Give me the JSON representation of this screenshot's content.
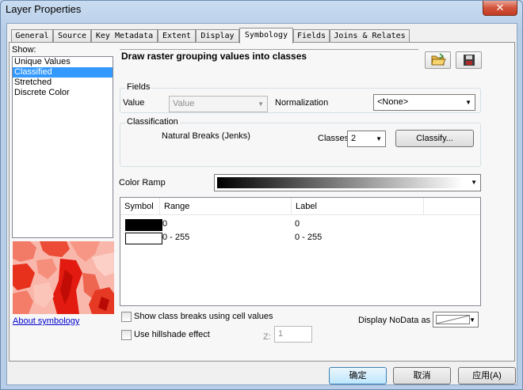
{
  "window": {
    "title": "Layer Properties",
    "close_glyph": "✕"
  },
  "tabs": [
    {
      "label": "General"
    },
    {
      "label": "Source"
    },
    {
      "label": "Key Metadata"
    },
    {
      "label": "Extent"
    },
    {
      "label": "Display"
    },
    {
      "label": "Symbology",
      "active": true
    },
    {
      "label": "Fields"
    },
    {
      "label": "Joins & Relates"
    }
  ],
  "show": {
    "label": "Show:",
    "items": [
      "Unique Values",
      "Classified",
      "Stretched",
      "Discrete Color"
    ],
    "selected": "Classified",
    "about_link": "About symbology"
  },
  "heading": "Draw raster grouping values into classes",
  "icons": {
    "open": "folder-open-icon",
    "save": "floppy-disk-icon"
  },
  "fields": {
    "legend": "Fields",
    "value_label": "Value",
    "value_combo": "Value",
    "normalization_label": "Normalization",
    "normalization_combo": "<None>"
  },
  "classification": {
    "legend": "Classification",
    "method": "Natural Breaks (Jenks)",
    "classes_label": "Classes",
    "classes_value": "2",
    "classify_button": "Classify..."
  },
  "color_ramp": {
    "label": "Color Ramp",
    "from_color": "#000000",
    "to_color": "#ffffff"
  },
  "table": {
    "columns": [
      "Symbol",
      "Range",
      "Label"
    ],
    "rows": [
      {
        "color": "#000000",
        "range": "0",
        "label": "0"
      },
      {
        "color": "#ffffff",
        "range": "0 - 255",
        "label": "0 - 255"
      }
    ]
  },
  "options": {
    "show_breaks_label": "Show class breaks using cell values",
    "hillshade_label": "Use hillshade effect",
    "z_label": "Z:",
    "z_value": "1",
    "nodata_label": "Display NoData as"
  },
  "buttons": {
    "ok": "确定",
    "cancel": "取消",
    "apply": "应用(A)"
  }
}
